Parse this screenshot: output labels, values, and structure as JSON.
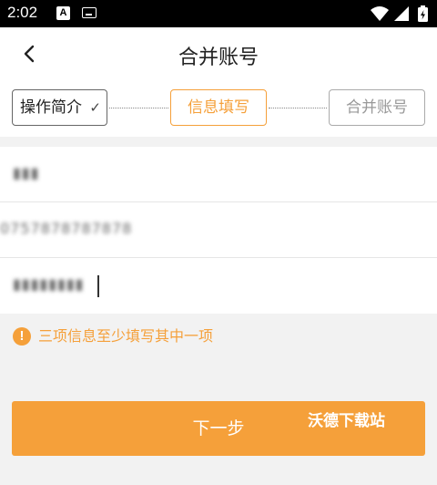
{
  "status_bar": {
    "time": "2:02",
    "notif_letter": "A"
  },
  "header": {
    "title": "合并账号"
  },
  "steps": [
    {
      "label": "操作简介",
      "state": "done"
    },
    {
      "label": "信息填写",
      "state": "active"
    },
    {
      "label": "合并账号",
      "state": "pending"
    }
  ],
  "form": {
    "fields": [
      {
        "value": "▮▮▮"
      },
      {
        "value": "0757878787878"
      },
      {
        "value": "▮▮▮▮▮▮▮▮"
      }
    ]
  },
  "hint": {
    "text": "三项信息至少填写其中一项"
  },
  "next_button": {
    "label": "下一步"
  },
  "watermark": "沃德下载站",
  "colors": {
    "accent": "#f5a03a",
    "background": "#f2f2f2"
  },
  "icons": [
    "back-arrow-icon",
    "checkmark-icon",
    "warning-icon",
    "wifi-icon",
    "signal-icon",
    "battery-icon"
  ]
}
